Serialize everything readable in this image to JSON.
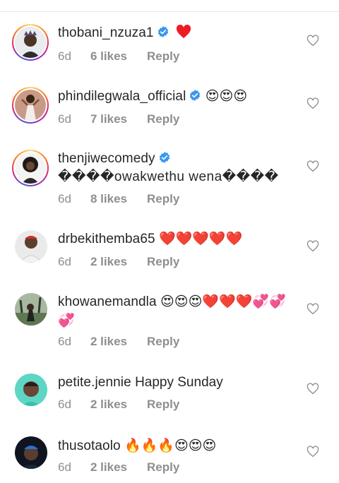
{
  "comments": [
    {
      "username": "thobani_nzuza1",
      "verified": true,
      "text": "❤️",
      "time": "6d",
      "likes": "6 likes",
      "reply": "Reply"
    },
    {
      "username": "phindilegwala_official",
      "verified": true,
      "text": "😍😍😍",
      "time": "6d",
      "likes": "7 likes",
      "reply": "Reply"
    },
    {
      "username": "thenjiwecomedy",
      "verified": true,
      "text": "����owakwethu wena����",
      "time": "6d",
      "likes": "8 likes",
      "reply": "Reply"
    },
    {
      "username": "drbekithemba65",
      "verified": false,
      "text": "❤️❤️❤️❤️❤️",
      "time": "6d",
      "likes": "2 likes",
      "reply": "Reply"
    },
    {
      "username": "khowanemandla",
      "verified": false,
      "text": "😍😍😍❤️❤️❤️💞💞💞",
      "time": "6d",
      "likes": "2 likes",
      "reply": "Reply"
    },
    {
      "username": "petite.jennie",
      "verified": false,
      "text": "Happy Sunday",
      "time": "6d",
      "likes": "2 likes",
      "reply": "Reply"
    },
    {
      "username": "thusotaolo",
      "verified": false,
      "text": "🔥🔥🔥😍😍😍",
      "time": "6d",
      "likes": "2 likes",
      "reply": "Reply"
    }
  ],
  "colors": {
    "username": "#262626",
    "meta": "#8e8e8e",
    "verified": "#3897f0",
    "heart_red": "#ed1c24",
    "like_outline": "#8e8e8e"
  },
  "icons": {
    "verified": "verified-badge-icon",
    "like": "heart-outline-icon",
    "emoji_heart": "red-heart-emoji"
  }
}
